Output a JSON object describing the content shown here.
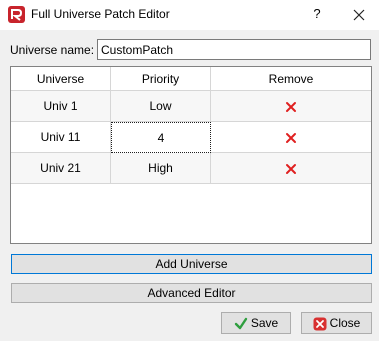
{
  "window": {
    "title": "Full Universe Patch Editor",
    "help_label": "?"
  },
  "universe_name": {
    "label": "Universe name:",
    "value": "CustomPatch"
  },
  "table": {
    "columns": [
      "Universe",
      "Priority",
      "Remove"
    ],
    "rows": [
      {
        "universe": "Univ 1",
        "priority": "Low"
      },
      {
        "universe": "Univ 11",
        "priority": "4"
      },
      {
        "universe": "Univ 21",
        "priority": "High"
      }
    ]
  },
  "buttons": {
    "add_universe": "Add Universe",
    "advanced_editor": "Advanced Editor",
    "save": "Save",
    "close": "Close"
  },
  "colors": {
    "remove_icon": "#e02020",
    "accent": "#0078d7",
    "save_check": "#2e9e3e",
    "close_icon_bg": "#d83030"
  },
  "icons": {
    "app": "app-logo-icon",
    "remove": "remove-x-icon",
    "save": "checkmark-icon",
    "close": "close-circle-icon"
  }
}
